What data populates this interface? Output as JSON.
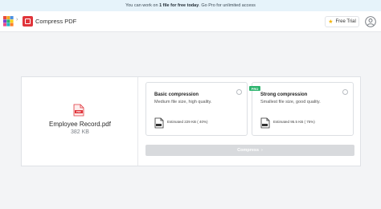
{
  "banner": {
    "prefix": "You can work on",
    "highlight": "1 file for free today",
    "suffix": ". Go Pro for unlimited access"
  },
  "header": {
    "tool_name": "Compress PDF",
    "free_trial_label": "Free Trial",
    "star_glyph": "★",
    "chevron_glyph": "›",
    "apps_icon_colors": [
      "#e94b3c",
      "#f5a623",
      "#4a90e2",
      "#7b3fd0",
      "#2db46e",
      "#f8d21c",
      "#e94b8a",
      "#1fb5c9",
      "#ff7f27"
    ]
  },
  "file": {
    "name": "Employee Record.pdf",
    "size": "382 KB",
    "icon_label": "PDF"
  },
  "options": [
    {
      "title": "Basic compression",
      "desc": "Medium file size, high quality.",
      "estimate": "Estimated 229 KB ( 40%)"
    },
    {
      "title": "Strong compression",
      "desc": "Smallest file size, good quality.",
      "estimate": "Estimated 95.5 KB ( 75%)",
      "badge": "PRO"
    }
  ],
  "compress_button": {
    "label": "Compress",
    "arrow": "›"
  },
  "colors": {
    "accent_red": "#e0353b",
    "pro_green": "#2db46e",
    "banner_bg": "#e6f3fa",
    "button_disabled": "#d8dadd"
  }
}
